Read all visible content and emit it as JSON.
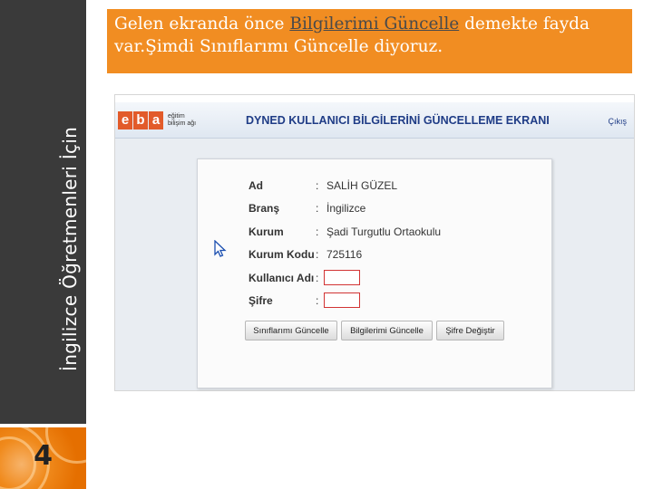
{
  "sidebar": {
    "title": "İngilizce Öğretmenleri İçin",
    "page_number": "4"
  },
  "instruction": {
    "part1": "Gelen ekranda önce ",
    "highlight": "Bilgilerimi Güncelle",
    "part2": " demekte fayda var.Şimdi Sınıflarımı Güncelle diyoruz."
  },
  "app": {
    "logo_letters": [
      "e",
      "b",
      "a"
    ],
    "logo_subtext": "eğitim bilişim ağı",
    "title": "DYNED KULLANICI BİLGİLERİNİ GÜNCELLEME EKRANI",
    "logout": "Çıkış",
    "form": {
      "fields": [
        {
          "label": "Ad",
          "value": "SALİH GÜZEL"
        },
        {
          "label": "Branş",
          "value": "İngilizce"
        },
        {
          "label": "Kurum",
          "value": "Şadi Turgutlu Ortaokulu"
        },
        {
          "label": "Kurum Kodu",
          "value": "725116"
        }
      ],
      "username_label": "Kullanıcı Adı",
      "password_label": "Şifre",
      "username_value": "",
      "password_value": "",
      "colon": ":"
    },
    "buttons": {
      "update_classes": "Sınıflarımı Güncelle",
      "update_info": "Bilgilerimi Güncelle",
      "change_password": "Şifre Değiştir"
    }
  },
  "colors": {
    "sidebar": "#3a3a3a",
    "instruction_bg": "#f18d22",
    "header_title": "#1f3c86",
    "logo": "#e25b2a"
  }
}
